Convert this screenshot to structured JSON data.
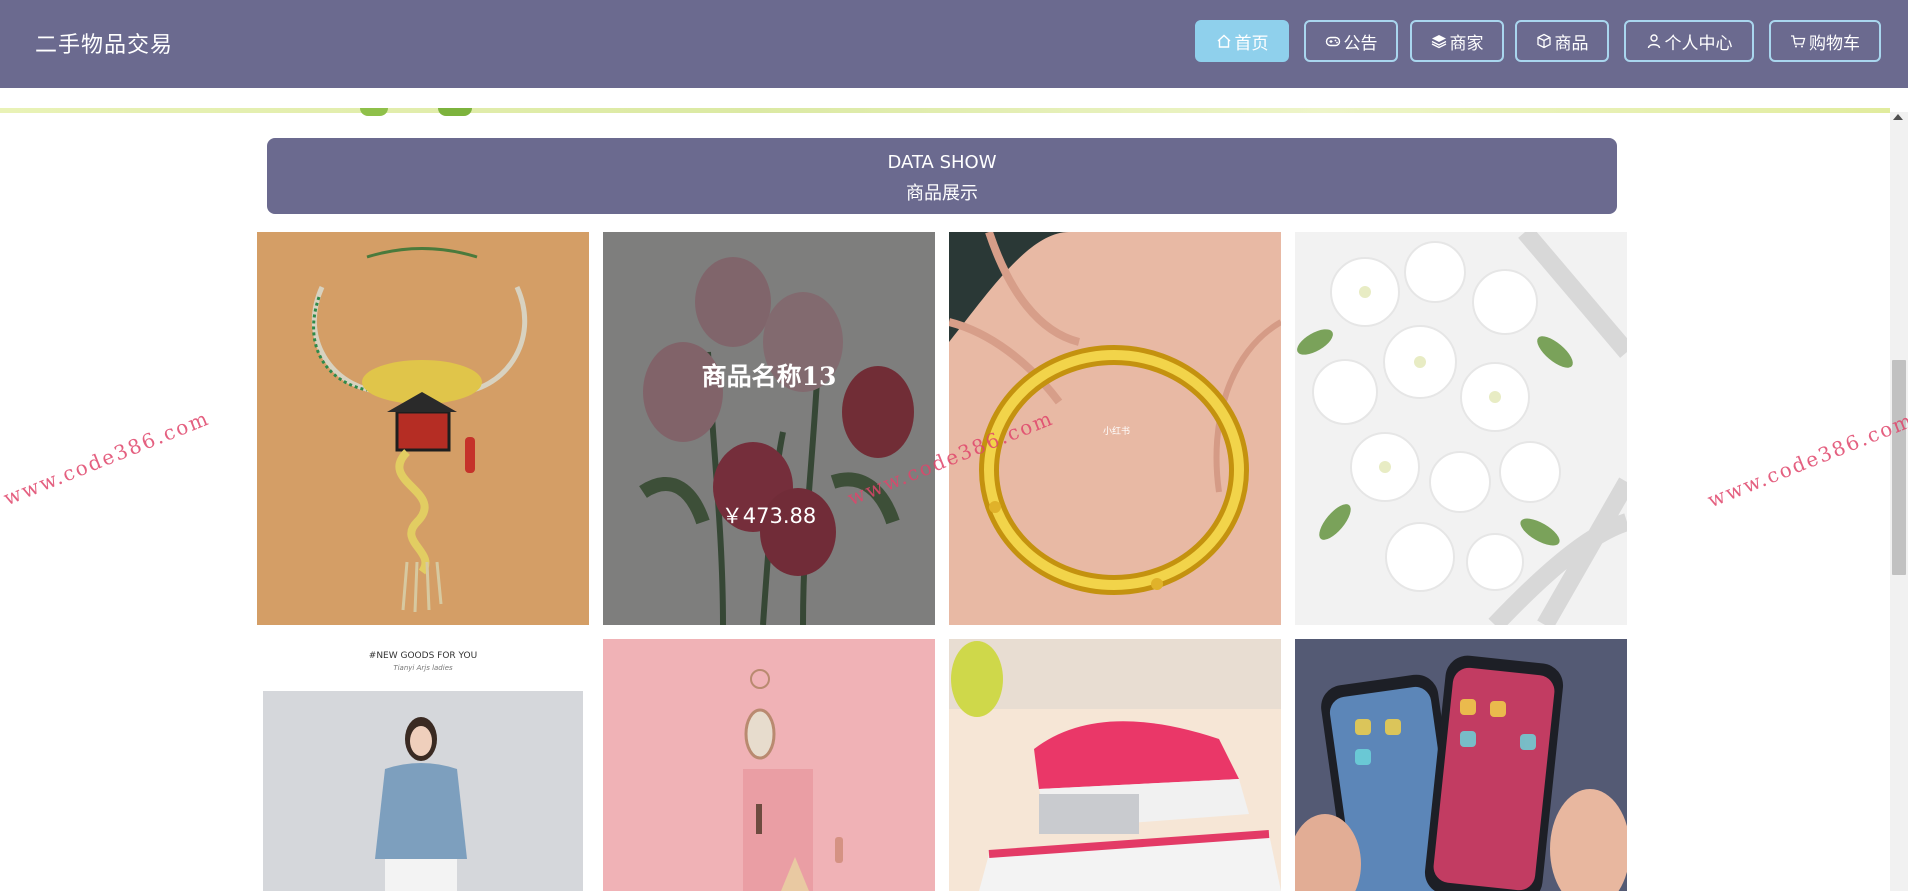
{
  "header": {
    "title": "二手物品交易",
    "nav": [
      {
        "label": "首页",
        "icon": "home-icon",
        "active": true
      },
      {
        "label": "公告",
        "icon": "gamepad-icon",
        "active": false
      },
      {
        "label": "商家",
        "icon": "layers-icon",
        "active": false
      },
      {
        "label": "商品",
        "icon": "box-icon",
        "active": false
      },
      {
        "label": "个人中心",
        "icon": "user-icon",
        "active": false
      },
      {
        "label": "购物车",
        "icon": "cart-icon",
        "active": false
      }
    ]
  },
  "section": {
    "title_en": "DATA SHOW",
    "title_cn": "商品展示"
  },
  "products": [
    {
      "image": "necklace"
    },
    {
      "image": "roses",
      "name": "商品名称13",
      "price": "￥473.88",
      "hovered": true
    },
    {
      "image": "gold-bracelet",
      "tiny_label": "小红书"
    },
    {
      "image": "white-flowers"
    },
    {
      "image": "woman-clothing",
      "banner_text": "#NEW GOODS FOR YOU",
      "banner_sub": "Tianyi Arjs ladies"
    },
    {
      "image": "pink-mirror"
    },
    {
      "image": "stapler"
    },
    {
      "image": "iphones"
    }
  ],
  "watermark": "www.code386.com",
  "colors": {
    "primary": "#6b6a8f",
    "nav_border": "#a9d6ee",
    "nav_active": "#8fd0ec",
    "watermark": "#e0456b"
  }
}
